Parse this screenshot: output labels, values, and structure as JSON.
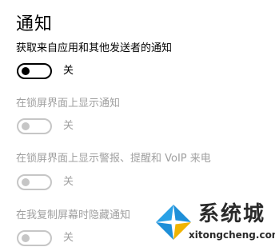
{
  "page": {
    "title": "通知"
  },
  "settings": [
    {
      "label": "获取来自应用和其他发送者的通知",
      "state": "关",
      "enabled": true
    },
    {
      "label": "在锁屏界面上显示通知",
      "state": "关",
      "enabled": false
    },
    {
      "label": "在锁屏界面上显示警报、提醒和 VoIP 来电",
      "state": "关",
      "enabled": false
    },
    {
      "label": "在我复制屏幕时隐藏通知",
      "state": "关",
      "enabled": false
    }
  ],
  "watermark": {
    "name": "系统城",
    "url": "xitongcheng.com",
    "logo_icon": "windows-logo-icon"
  },
  "colors": {
    "enabled_text": "#000000",
    "disabled_text": "#a0a0a0",
    "disabled_toggle": "#c6c6c6",
    "watermark_blue": "#1e8fd8"
  }
}
